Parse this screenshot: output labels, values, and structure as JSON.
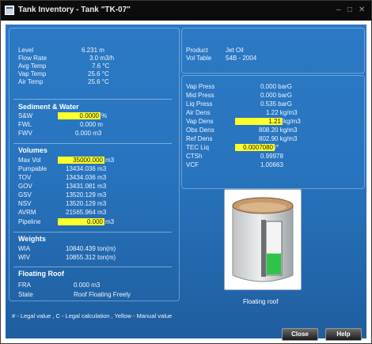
{
  "window": {
    "title": "Tank Inventory - Tank \"TK-07\"",
    "controls": {
      "minimize": "–",
      "maximize": "□",
      "close": "✕"
    }
  },
  "status": [
    {
      "label": "Level",
      "value": "6.231 m"
    },
    {
      "label": "Flow Rate",
      "value": "3.0 m3/h"
    },
    {
      "label": "Avg Temp",
      "value": "7.6 °C"
    },
    {
      "label": "Vap Temp",
      "value": "25.6 °C"
    },
    {
      "label": "Air Temp",
      "value": "25.6 °C"
    }
  ],
  "product": {
    "product_label": "Product",
    "product_value": "Jet Oil",
    "vol_table_label": "Vol Table",
    "vol_table_value": "54B - 2004"
  },
  "sediment": {
    "heading": "Sediment & Water",
    "rows": [
      {
        "label": "S&W",
        "value": "0.0000",
        "unit": "%",
        "highlight": true
      },
      {
        "label": "FWL",
        "value": "0.000 m",
        "unit": "",
        "highlight": false
      },
      {
        "label": "FWV",
        "value": "0.000 m3",
        "unit": "",
        "highlight": false
      }
    ]
  },
  "density": [
    {
      "label": "Vap Press",
      "value": "0.000 barG",
      "unit": "",
      "highlight": false
    },
    {
      "label": "Mid Press",
      "value": "0.000 barG",
      "unit": "",
      "highlight": false
    },
    {
      "label": "Liq Press",
      "value": "0.535 barG",
      "unit": "",
      "highlight": false
    },
    {
      "label": "Air Dens",
      "value": "1.22 kg/m3",
      "unit": "",
      "highlight": false
    },
    {
      "label": "Vap Dens",
      "value": "1.21",
      "unit": "kg/m3",
      "highlight": true
    },
    {
      "label": "Obs Dens",
      "value": "808.20 kg/m3",
      "unit": "",
      "highlight": false
    },
    {
      "label": "Ref Dens",
      "value": "802.90 kg/m3",
      "unit": "",
      "highlight": false
    },
    {
      "label": "TEC Liq",
      "value": "0.0007080",
      "unit": "/°",
      "highlight": true
    },
    {
      "label": "CTSh",
      "value": "0.99978",
      "unit": "",
      "highlight": false
    },
    {
      "label": "VCF",
      "value": "1.00663",
      "unit": "",
      "highlight": false
    }
  ],
  "volumes": {
    "heading": "Volumes",
    "rows": [
      {
        "label": "Max Vol",
        "value": "35000.000",
        "unit": "m3",
        "highlight": true
      },
      {
        "label": "Pumpable",
        "value": "13434.036 m3",
        "unit": "",
        "highlight": false
      },
      {
        "label": "TOV",
        "value": "13434.036 m3",
        "unit": "",
        "highlight": false
      },
      {
        "label": "GOV",
        "value": "13431.081 m3",
        "unit": "",
        "highlight": false
      },
      {
        "label": "GSV",
        "value": "13520.129 m3",
        "unit": "",
        "highlight": false
      },
      {
        "label": "NSV",
        "value": "13520.129 m3",
        "unit": "",
        "highlight": false
      },
      {
        "label": "AVRM",
        "value": "21565.964 m3",
        "unit": "",
        "highlight": false
      },
      {
        "label": "Pipeline",
        "value": "0.000",
        "unit": "m3",
        "highlight": true
      }
    ]
  },
  "weights": {
    "heading": "Weights",
    "rows": [
      {
        "label": "WIA",
        "value": "10840.439 ton(m)"
      },
      {
        "label": "WIV",
        "value": "10855.312 ton(m)"
      }
    ]
  },
  "floating_roof": {
    "heading": "Floating Roof",
    "rows": [
      {
        "label": "FRA",
        "value": "0.000 m3"
      },
      {
        "label": "State",
        "value": "Roof Floating Freely"
      }
    ]
  },
  "tank_graphic": {
    "caption": "Floating roof",
    "fill_fraction": 0.4
  },
  "legend": "# - Legal value , C - Legal calculation , Yellow - Manual value",
  "buttons": {
    "close": "Close",
    "help": "Help"
  }
}
